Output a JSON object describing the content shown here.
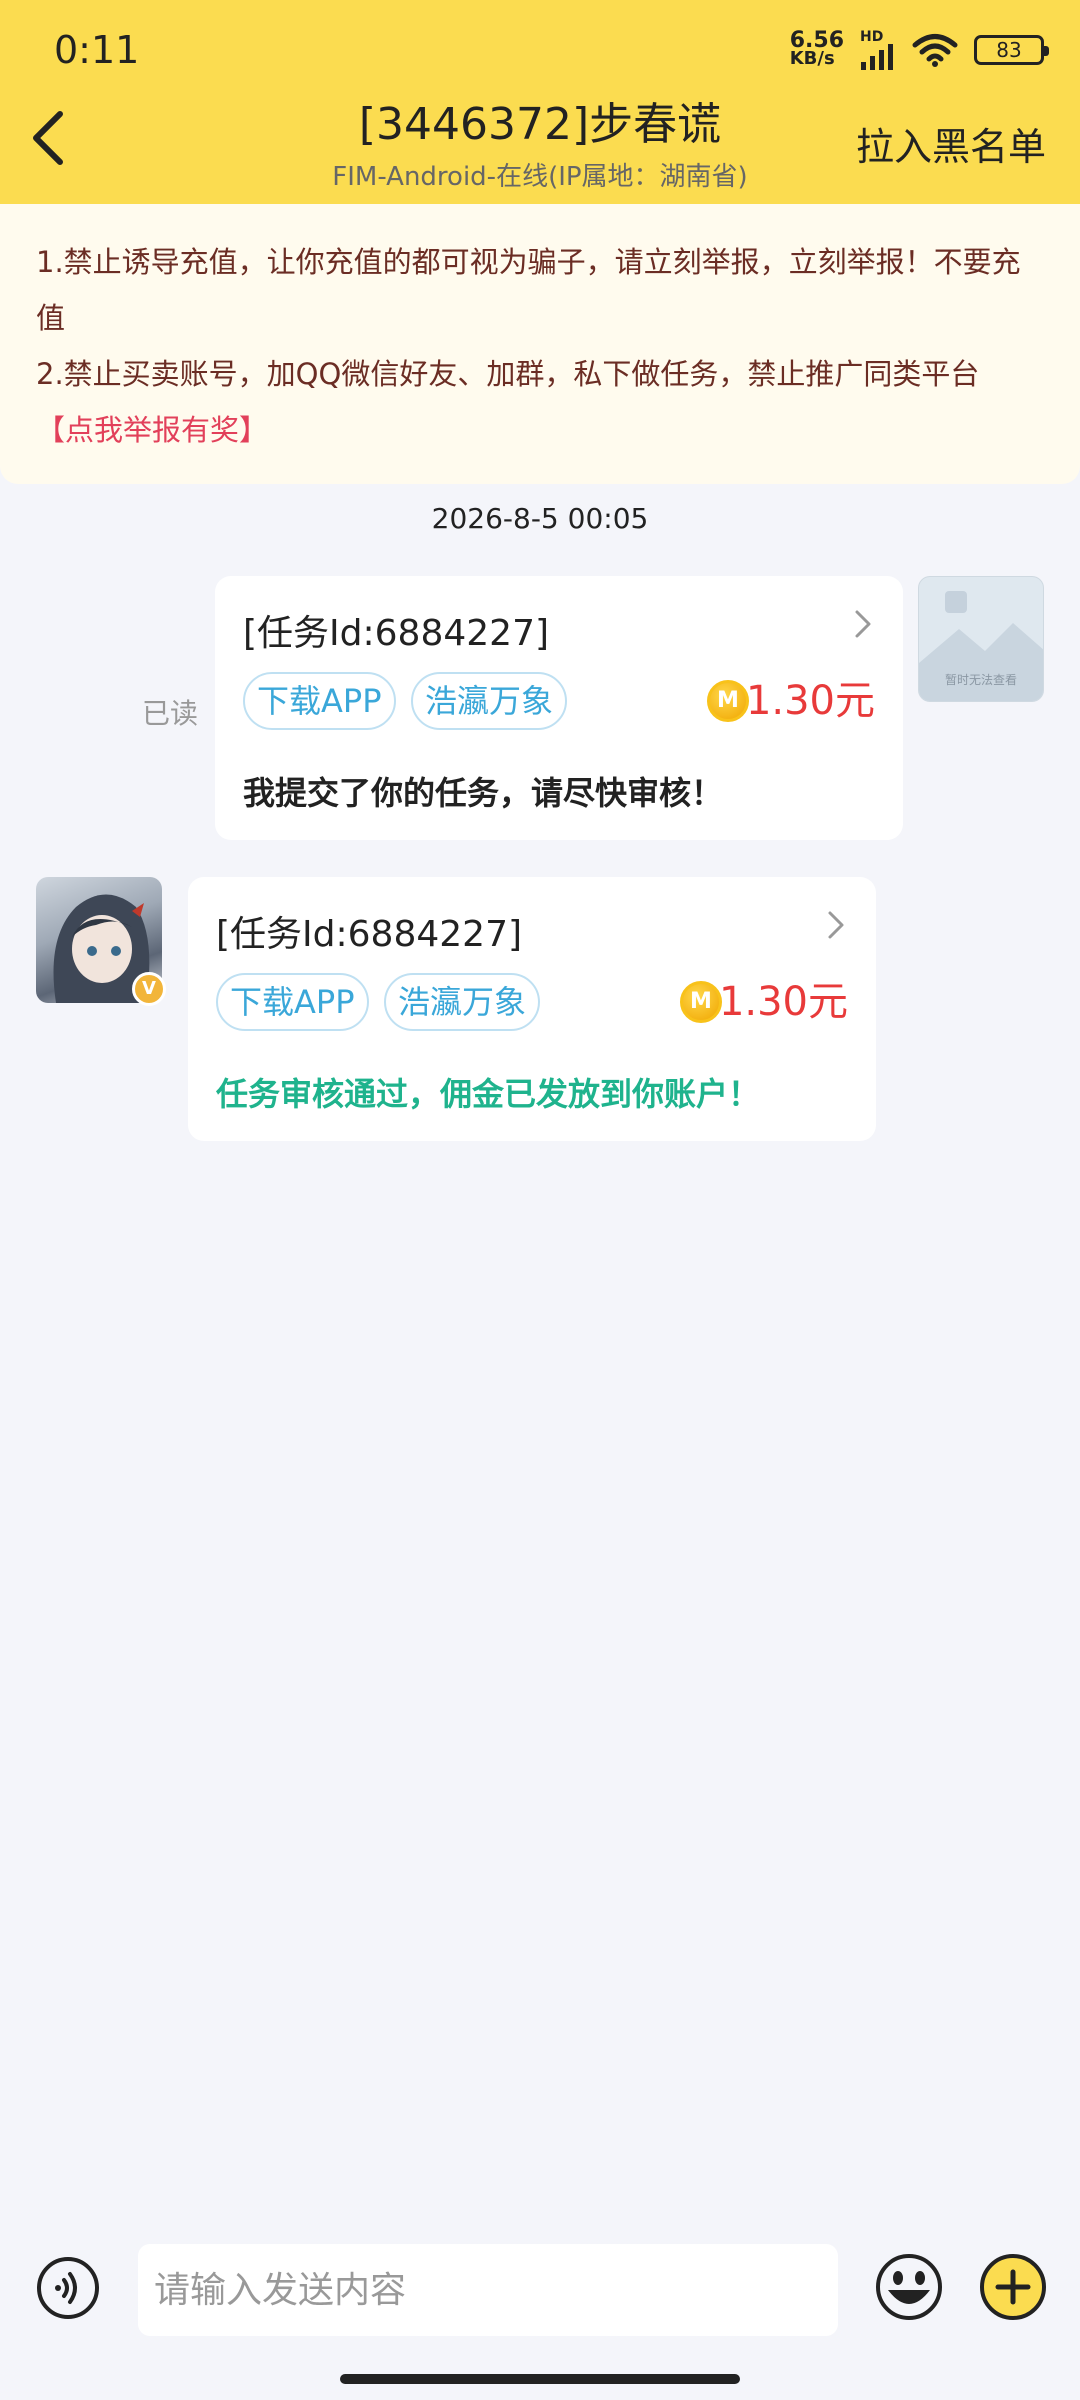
{
  "status_bar": {
    "time": "0:11",
    "net_speed_value": "6.56",
    "net_speed_unit": "KB/s",
    "signal_label": "HD",
    "battery": "83"
  },
  "header": {
    "title": "[3446372]步春谎",
    "subtitle": "FIM-Android-在线(IP属地：湖南省)",
    "blacklist_label": "拉入黑名单",
    "back_icon": "chevron-left-icon",
    "background_color": "#fbdc50"
  },
  "notice": {
    "line1": "1.禁止诱导充值，让你充值的都可视为骗子，请立刻举报，立刻举报！不要充值",
    "line2": "2.禁止买卖账号，加QQ微信好友、加群，私下做任务，禁止推广同类平台",
    "report_link": "【点我举报有奖】"
  },
  "chat": {
    "timestamp": "2026-8-5 00:05",
    "messages": [
      {
        "direction": "sent",
        "read_label": "已读",
        "task_id": "[任务Id:6884227]",
        "tags": [
          "下载APP",
          "浩瀛万象"
        ],
        "coin_letter": "M",
        "price": "1.30元",
        "text": "我提交了你的任务，请尽快审核！",
        "avatar_caption": "暂时无法查看"
      },
      {
        "direction": "received",
        "task_id": "[任务Id:6884227]",
        "tags": [
          "下载APP",
          "浩瀛万象"
        ],
        "coin_letter": "M",
        "price": "1.30元",
        "text": "任务审核通过，佣金已发放到你账户！",
        "vip_badge": "V"
      }
    ]
  },
  "input_bar": {
    "placeholder": "请输入发送内容",
    "voice_icon": "voice-icon",
    "emoji_icon": "emoji-icon",
    "plus_icon": "plus-icon"
  },
  "colors": {
    "price": "#e83a3a",
    "approved_text": "#1fb38d",
    "tag": "#3aa7d9",
    "notice_text": "#6b2d24",
    "report_link": "#e2405a"
  }
}
